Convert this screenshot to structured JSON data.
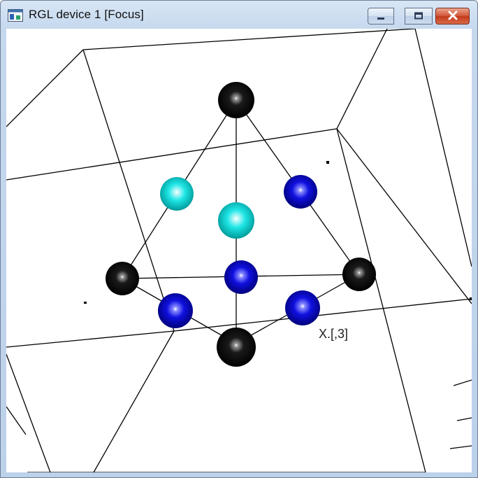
{
  "window": {
    "title": "RGL device 1 [Focus]",
    "app_icon": "rgl-window-icon",
    "controls": {
      "minimize_icon": "minimize-icon",
      "maximize_icon": "maximize-icon",
      "close_icon": "close-icon"
    }
  },
  "scene": {
    "axis_label": "X.[,3]",
    "sphere_colors": {
      "black": "#000000",
      "cyan": "#00e5e5",
      "blue": "#0000dd"
    }
  }
}
